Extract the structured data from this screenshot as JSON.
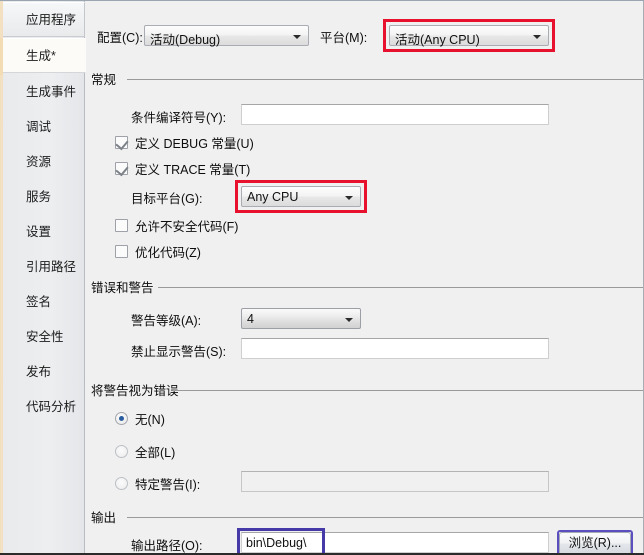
{
  "window": {
    "accent_selected": "#f3dcb4",
    "annotation_red": "#e8112d",
    "annotation_blue": "#4639a8"
  },
  "sidebar": {
    "items": [
      {
        "label": "应用程序",
        "state": "normal"
      },
      {
        "label": "生成*",
        "state": "selected"
      },
      {
        "label": "生成事件",
        "state": "normal"
      },
      {
        "label": "调试",
        "state": "normal"
      },
      {
        "label": "资源",
        "state": "normal"
      },
      {
        "label": "服务",
        "state": "normal"
      },
      {
        "label": "设置",
        "state": "normal"
      },
      {
        "label": "引用路径",
        "state": "normal"
      },
      {
        "label": "签名",
        "state": "normal"
      },
      {
        "label": "安全性",
        "state": "normal"
      },
      {
        "label": "发布",
        "state": "normal"
      },
      {
        "label": "代码分析",
        "state": "normal"
      }
    ]
  },
  "top_bar": {
    "configuration_label": "配置(C):",
    "configuration_value": "活动(Debug)",
    "platform_label": "平台(M):",
    "platform_value": "活动(Any CPU)",
    "platform_highlighted": true
  },
  "general": {
    "group_label": "常规",
    "conditional_symbols_label": "条件编译符号(Y):",
    "conditional_symbols_value": "",
    "define_debug_label": "定义 DEBUG 常量(U)",
    "define_debug_checked": true,
    "define_trace_label": "定义 TRACE 常量(T)",
    "define_trace_checked": true,
    "target_platform_label": "目标平台(G):",
    "target_platform_value": "Any CPU",
    "target_platform_highlighted": true,
    "allow_unsafe_label": "允许不安全代码(F)",
    "allow_unsafe_checked": false,
    "optimize_label": "优化代码(Z)",
    "optimize_checked": false
  },
  "errors_warnings": {
    "group_label": "错误和警告",
    "warning_level_label": "警告等级(A):",
    "warning_level_value": "4",
    "suppress_warnings_label": "禁止显示警告(S):",
    "suppress_warnings_value": ""
  },
  "warnings_as_errors": {
    "group_label": "将警告视为错误",
    "options": [
      {
        "label": "无(N)",
        "selected": true
      },
      {
        "label": "全部(L)",
        "selected": false
      },
      {
        "label": "特定警告(I):",
        "selected": false
      }
    ],
    "specific_warnings_value": ""
  },
  "output": {
    "group_label": "输出",
    "output_path_label": "输出路径(O):",
    "output_path_value": "bin\\Debug\\",
    "output_path_highlighted": true,
    "browse_label": "浏览(R)..."
  }
}
